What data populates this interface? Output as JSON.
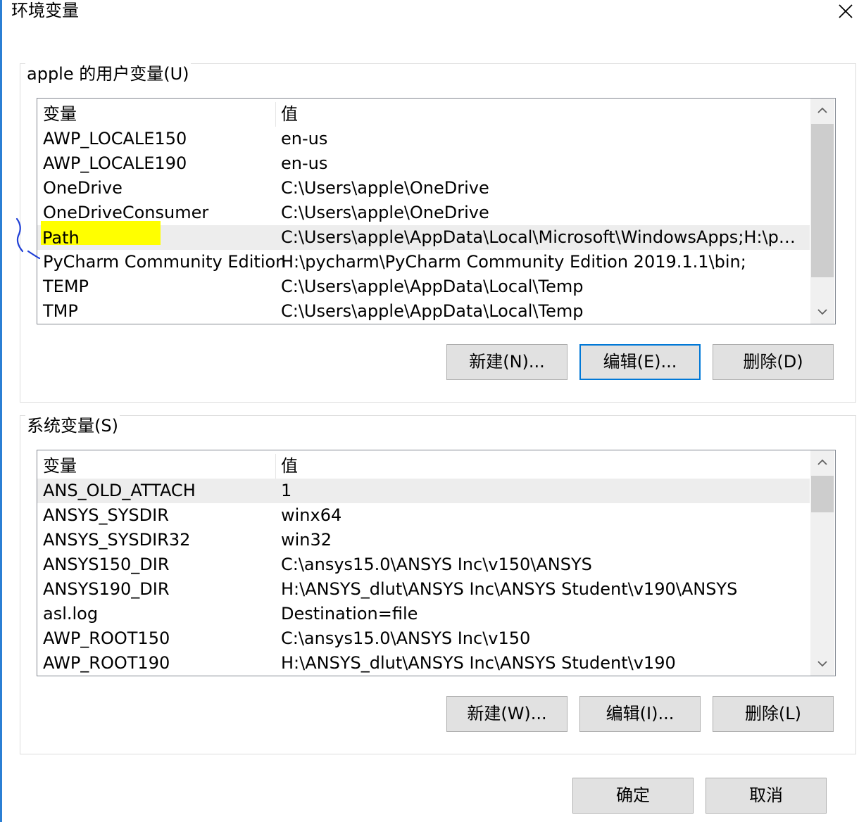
{
  "window": {
    "title": "环境变量"
  },
  "user_group": {
    "label": "apple 的用户变量(U)",
    "headers": {
      "name": "变量",
      "value": "值"
    },
    "rows": [
      {
        "name": "AWP_LOCALE150",
        "value": "en-us"
      },
      {
        "name": "AWP_LOCALE190",
        "value": "en-us"
      },
      {
        "name": "OneDrive",
        "value": "C:\\Users\\apple\\OneDrive"
      },
      {
        "name": "OneDriveConsumer",
        "value": "C:\\Users\\apple\\OneDrive"
      },
      {
        "name": "Path",
        "value": "C:\\Users\\apple\\AppData\\Local\\Microsoft\\WindowsApps;H:\\pyc..."
      },
      {
        "name": "PyCharm Community Edition",
        "value": "H:\\pycharm\\PyCharm Community Edition 2019.1.1\\bin;"
      },
      {
        "name": "TEMP",
        "value": "C:\\Users\\apple\\AppData\\Local\\Temp"
      },
      {
        "name": "TMP",
        "value": "C:\\Users\\apple\\AppData\\Local\\Temp"
      }
    ],
    "buttons": {
      "new": "新建(N)...",
      "edit": "编辑(E)...",
      "delete": "删除(D)"
    }
  },
  "system_group": {
    "label": "系统变量(S)",
    "headers": {
      "name": "变量",
      "value": "值"
    },
    "rows": [
      {
        "name": "ANS_OLD_ATTACH",
        "value": "1"
      },
      {
        "name": "ANSYS_SYSDIR",
        "value": "winx64"
      },
      {
        "name": "ANSYS_SYSDIR32",
        "value": "win32"
      },
      {
        "name": "ANSYS150_DIR",
        "value": "C:\\ansys15.0\\ANSYS Inc\\v150\\ANSYS"
      },
      {
        "name": "ANSYS190_DIR",
        "value": "H:\\ANSYS_dlut\\ANSYS Inc\\ANSYS Student\\v190\\ANSYS"
      },
      {
        "name": "asl.log",
        "value": "Destination=file"
      },
      {
        "name": "AWP_ROOT150",
        "value": "C:\\ansys15.0\\ANSYS Inc\\v150"
      },
      {
        "name": "AWP_ROOT190",
        "value": "H:\\ANSYS_dlut\\ANSYS Inc\\ANSYS Student\\v190"
      }
    ],
    "buttons": {
      "new": "新建(W)...",
      "edit": "编辑(I)...",
      "delete": "删除(L)"
    }
  },
  "dialog_buttons": {
    "ok": "确定",
    "cancel": "取消"
  },
  "icons": {
    "close": "close-icon",
    "scroll_up": "chevron-up-icon",
    "scroll_down": "chevron-down-icon"
  },
  "colors": {
    "selection": "#ededed",
    "highlight": "#ffff00",
    "focus_border": "#0078d7",
    "annotation": "#1f3fd6"
  }
}
